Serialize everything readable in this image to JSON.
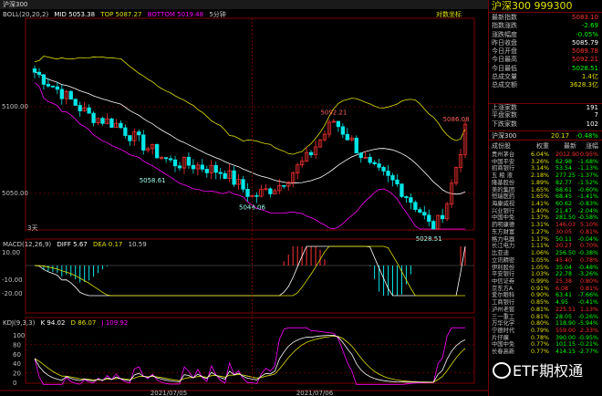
{
  "title_bar": {
    "symbol": "沪深300",
    "indicator": "BOLL(20,20,2)",
    "mid": "MID 5053.38",
    "top": "TOP 5087.27",
    "bottom": "BOTTOM 5019.48",
    "period": "5分钟",
    "right_tag": "对数坐标"
  },
  "price_axis": {
    "labels": [
      "5100.00",
      "5050.00"
    ]
  },
  "price_annotations": {
    "a": "5058.61",
    "b": "5048.06",
    "c": "5092.21",
    "d": "5086.08",
    "e": "5028.51",
    "days": "3天"
  },
  "macd": {
    "label": "MACD(12,26,9)",
    "diff": "DIFF 5.67",
    "dea": "DEA 0.17",
    "macd": "10.59",
    "axis": [
      "10.00",
      "-10.00",
      "-20.00"
    ]
  },
  "kdj": {
    "label": "KDJ(9,3,3)",
    "k": "K 94.02",
    "d": "D 86.07",
    "j": "J 109.92",
    "axis": [
      "100",
      "80",
      "60",
      "40",
      "20",
      "0"
    ]
  },
  "dates": [
    "2021/07/05",
    "2021/07/06"
  ],
  "colors": {
    "up": "#ff3232",
    "down": "#00e6e6",
    "mid": "#ffffff",
    "top": "#e0e000",
    "bottom": "#ff00ff",
    "accent": "#e0e000"
  },
  "panel": {
    "title": "沪深300  999300",
    "quote_rows": [
      {
        "label": "最新指数",
        "value": "5083.10",
        "color": "#ff3232"
      },
      {
        "label": "指数涨跌",
        "value": "-2.69",
        "color": "#00ff00"
      },
      {
        "label": "涨跌幅度",
        "value": "-0.05%",
        "color": "#00ff00"
      },
      {
        "label": "昨日收盘",
        "value": "5085.79",
        "color": "#ffffff"
      },
      {
        "label": "今日开盘",
        "value": "5089.78",
        "color": "#ff3232"
      },
      {
        "label": "今日最高",
        "value": "5092.21",
        "color": "#ff3232"
      },
      {
        "label": "今日最低",
        "value": "5028.51",
        "color": "#00ff00"
      },
      {
        "label": "总成交量",
        "value": "1.4亿",
        "color": "#e0e000"
      },
      {
        "label": "总成交额",
        "value": "3628.3亿",
        "color": "#e0e000"
      }
    ],
    "stats": [
      {
        "label": "上涨家数",
        "value": "191",
        "color": "#ffffff"
      },
      {
        "label": "平盘家数",
        "value": "7",
        "color": "#ffffff"
      },
      {
        "label": "下跌家数",
        "value": "102",
        "color": "#ffffff"
      }
    ],
    "index_line": {
      "name": "沪深300",
      "change": "20.17",
      "pct": "-0.48%"
    },
    "stock_header": {
      "name": "成份股",
      "weight": "权重",
      "price": "最新",
      "chg": "涨幅"
    },
    "stocks": [
      {
        "name": "贵州茅台",
        "w": "6.04%",
        "p": "2012.90",
        "c": "0.95%",
        "up": true
      },
      {
        "name": "中国平安",
        "w": "3.26%",
        "p": "62.98",
        "c": "-1.68%",
        "up": false
      },
      {
        "name": "招商银行",
        "w": "3.14%",
        "p": "53.54",
        "c": "-1.13%",
        "up": false
      },
      {
        "name": "五 粮 液",
        "w": "2.18%",
        "p": "277.25",
        "c": "-1.37%",
        "up": false
      },
      {
        "name": "隆基股份",
        "w": "1.89%",
        "p": "82.77",
        "c": "-1.52%",
        "up": false
      },
      {
        "name": "美的集团",
        "w": "1.65%",
        "p": "68.61",
        "c": "-0.60%",
        "up": false
      },
      {
        "name": "恒瑞医药",
        "w": "1.65%",
        "p": "68.45",
        "c": "-1.41%",
        "up": false
      },
      {
        "name": "海康威视",
        "w": "1.41%",
        "p": "60.62",
        "c": "-0.83%",
        "up": false
      },
      {
        "name": "兴业银行",
        "w": "1.40%",
        "p": "21.47",
        "c": "-2.04%",
        "up": false
      },
      {
        "name": "中国中免",
        "w": "1.37%",
        "p": "281.50",
        "c": "-0.58%",
        "up": false
      },
      {
        "name": "药明康德",
        "w": "1.31%",
        "p": "146.03",
        "c": "5.10%",
        "up": true
      },
      {
        "name": "东方财富",
        "w": "1.27%",
        "p": "30.05",
        "c": "0.81%",
        "up": true
      },
      {
        "name": "格力电器",
        "w": "1.17%",
        "p": "50.11",
        "c": "-0.04%",
        "up": false
      },
      {
        "name": "长江电力",
        "w": "1.11%",
        "p": "20.27",
        "c": "0.70%",
        "up": true
      },
      {
        "name": "比亚迪",
        "w": "1.06%",
        "p": "256.50",
        "c": "-0.38%",
        "up": false
      },
      {
        "name": "立讯精密",
        "w": "1.05%",
        "p": "45.40",
        "c": "0.78%",
        "up": true
      },
      {
        "name": "伊利股份",
        "w": "1.05%",
        "p": "35.04",
        "c": "-0.48%",
        "up": false
      },
      {
        "name": "平安银行",
        "w": "1.03%",
        "p": "22.78",
        "c": "-3.26%",
        "up": false
      },
      {
        "name": "中信证券",
        "w": "0.99%",
        "p": "25.38",
        "c": "0.80%",
        "up": true
      },
      {
        "name": "京东方A",
        "w": "0.91%",
        "p": "6.08",
        "c": "0.81%",
        "up": true
      },
      {
        "name": "爱尔眼科",
        "w": "0.90%",
        "p": "63.41",
        "c": "-7.66%",
        "up": false
      },
      {
        "name": "工商银行",
        "w": "0.85%",
        "p": "4.95",
        "c": "-0.41%",
        "up": false
      },
      {
        "name": "泸州老窖",
        "w": "0.81%",
        "p": "225.51",
        "c": "1.13%",
        "up": true
      },
      {
        "name": "三一重工",
        "w": "0.81%",
        "p": "28.05",
        "c": "-0.26%",
        "up": false
      },
      {
        "name": "万华化学",
        "w": "0.80%",
        "p": "118.90",
        "c": "-5.94%",
        "up": false
      },
      {
        "name": "宁德时代",
        "w": "0.79%",
        "p": "559.00",
        "c": "2.33%",
        "up": true
      },
      {
        "name": "片仔癀",
        "w": "0.78%",
        "p": "390.00",
        "c": "-0.95%",
        "up": false
      },
      {
        "name": "中国中免",
        "w": "0.77%",
        "p": "101.15",
        "c": "-0.21%",
        "up": false
      },
      {
        "name": "长春高新",
        "w": "0.77%",
        "p": "414.15",
        "c": "-2.77%",
        "up": false
      }
    ]
  },
  "watermark": "ETF期权通"
}
